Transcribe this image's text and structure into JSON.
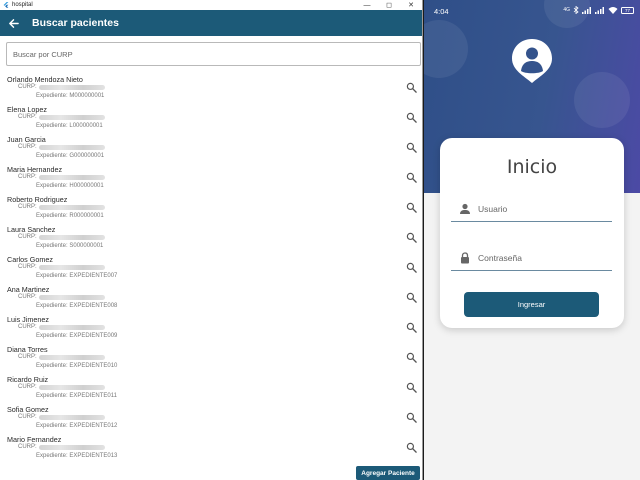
{
  "window": {
    "app_title": "hospital",
    "minimize": "—",
    "maximize": "◻",
    "close": "✕"
  },
  "search_screen": {
    "title": "Buscar pacientes",
    "search_placeholder": "Buscar por CURP",
    "curp_label": "CURP:",
    "patients": [
      {
        "name": "Orlando Mendoza Nieto",
        "expediente": "Expediente: M000000001"
      },
      {
        "name": "Elena Lopez",
        "expediente": "Expediente: L000000001"
      },
      {
        "name": "Juan Garcia",
        "expediente": "Expediente: G000000001"
      },
      {
        "name": "Maria Hernandez",
        "expediente": "Expediente: H000000001"
      },
      {
        "name": "Roberto Rodriguez",
        "expediente": "Expediente: R000000001"
      },
      {
        "name": "Laura Sanchez",
        "expediente": "Expediente: S000000001"
      },
      {
        "name": "Carlos Gomez",
        "expediente": "Expediente: EXPEDIENTE007"
      },
      {
        "name": "Ana Martinez",
        "expediente": "Expediente: EXPEDIENTE008"
      },
      {
        "name": "Luis Jimenez",
        "expediente": "Expediente: EXPEDIENTE009"
      },
      {
        "name": "Diana Torres",
        "expediente": "Expediente: EXPEDIENTE010"
      },
      {
        "name": "Ricardo Ruiz",
        "expediente": "Expediente: EXPEDIENTE011"
      },
      {
        "name": "Sofia Gomez",
        "expediente": "Expediente: EXPEDIENTE012"
      },
      {
        "name": "Mario Fernandez",
        "expediente": "Expediente: EXPEDIENTE013"
      }
    ],
    "add_button": "Agregar Paciente"
  },
  "login_screen": {
    "status_time": "4:04",
    "status_net": "4G",
    "battery": "77",
    "title": "Inicio",
    "user_placeholder": "Usuario",
    "password_placeholder": "Contraseña",
    "login_button": "Ingresar"
  },
  "colors": {
    "primary": "#1c5a78",
    "header_start": "#2f4f88",
    "header_end": "#4c4aa5"
  }
}
